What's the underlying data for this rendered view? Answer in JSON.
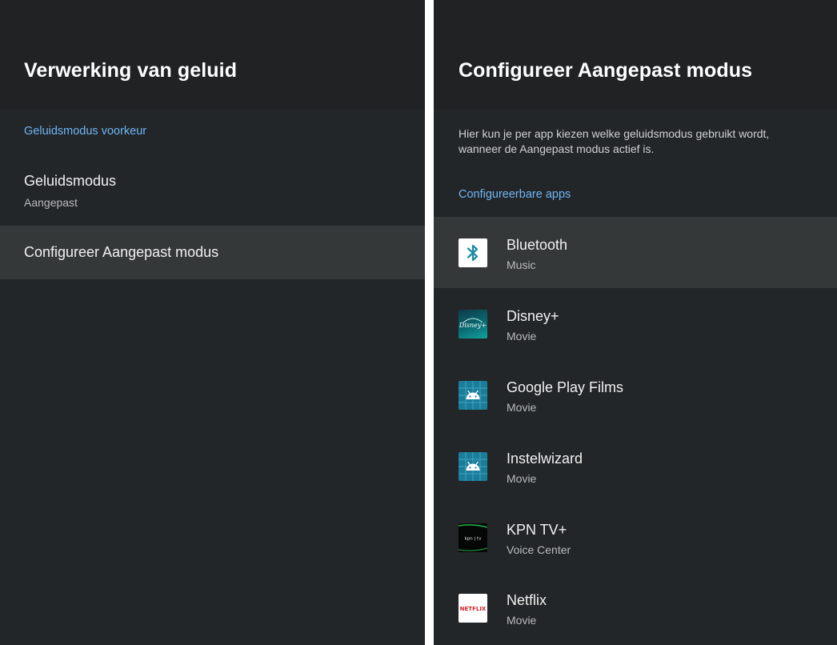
{
  "left_panel": {
    "title": "Verwerking van geluid",
    "section_label": "Geluidsmodus voorkeur",
    "items": [
      {
        "title": "Geluidsmodus",
        "subtitle": "Aangepast"
      },
      {
        "title": "Configureer Aangepast modus",
        "subtitle": ""
      }
    ]
  },
  "right_panel": {
    "title": "Configureer Aangepast modus",
    "description": "Hier kun je per app kiezen welke geluidsmodus gebruikt wordt, wanneer de Aangepast modus actief is.",
    "section_label": "Configureerbare apps",
    "apps": [
      {
        "name": "Bluetooth",
        "mode": "Music",
        "icon": "bluetooth-icon"
      },
      {
        "name": "Disney+",
        "mode": "Movie",
        "icon": "disney-plus-icon"
      },
      {
        "name": "Google Play Films",
        "mode": "Movie",
        "icon": "android-icon"
      },
      {
        "name": "Instelwizard",
        "mode": "Movie",
        "icon": "android-icon"
      },
      {
        "name": "KPN TV+",
        "mode": "Voice Center",
        "icon": "kpn-tv-icon"
      },
      {
        "name": "Netflix",
        "mode": "Movie",
        "icon": "netflix-icon"
      }
    ],
    "icon_text": {
      "disney": "Disney+",
      "kpn": "kpn | tv",
      "netflix": "NETFLIX"
    }
  },
  "colors": {
    "background": "#232628",
    "header": "#212224",
    "selected_row": "#353839",
    "accent": "#6eb6f5",
    "android_icon_bg": "#1b7d9a"
  }
}
